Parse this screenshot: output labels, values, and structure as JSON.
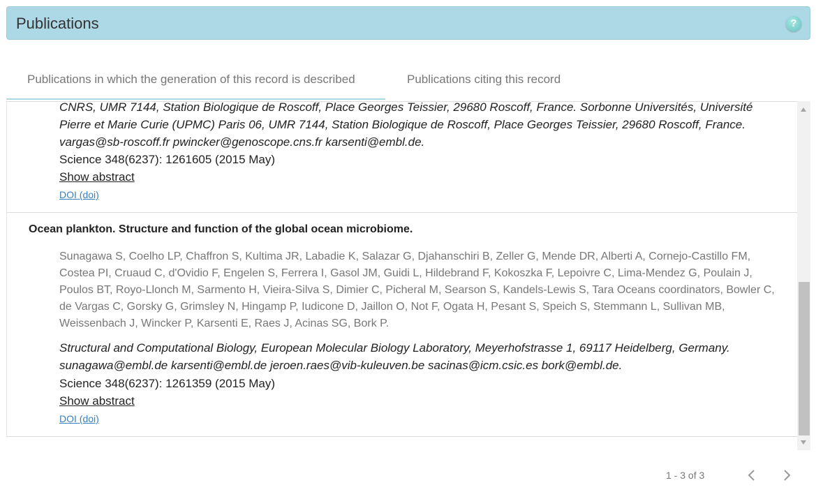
{
  "panel": {
    "title": "Publications",
    "help_icon": "?"
  },
  "tabs": [
    {
      "label": "Publications in which the generation of this record is described",
      "active": true
    },
    {
      "label": "Publications citing this record",
      "active": false
    }
  ],
  "publications": [
    {
      "affiliation": "CNRS, UMR 7144, Station Biologique de Roscoff, Place Georges Teissier, 29680 Roscoff, France. Sorbonne Universités, Université Pierre et Marie Curie (UPMC) Paris 06, UMR 7144, Station Biologique de Roscoff, Place Georges Teissier, 29680 Roscoff, France. vargas@sb-roscoff.fr pwincker@genoscope.cns.fr karsenti@embl.de.",
      "journal": "Science 348(6237): 1261605 (2015 May)",
      "show_abstract": "Show abstract",
      "doi_label": "DOI (doi)"
    },
    {
      "title": "Ocean plankton. Structure and function of the global ocean microbiome.",
      "authors": "Sunagawa S, Coelho LP, Chaffron S, Kultima JR, Labadie K, Salazar G, Djahanschiri B, Zeller G, Mende DR, Alberti A, Cornejo-Castillo FM, Costea PI, Cruaud C, d'Ovidio F, Engelen S, Ferrera I, Gasol JM, Guidi L, Hildebrand F, Kokoszka F, Lepoivre C, Lima-Mendez G, Poulain J, Poulos BT, Royo-Llonch M, Sarmento H, Vieira-Silva S, Dimier C, Picheral M, Searson S, Kandels-Lewis S, Tara Oceans coordinators, Bowler C, de Vargas C, Gorsky G, Grimsley N, Hingamp P, Iudicone D, Jaillon O, Not F, Ogata H, Pesant S, Speich S, Stemmann L, Sullivan MB, Weissenbach J, Wincker P, Karsenti E, Raes J, Acinas SG, Bork P.",
      "affiliation": "Structural and Computational Biology, European Molecular Biology Laboratory, Meyerhofstrasse 1, 69117 Heidelberg, Germany. sunagawa@embl.de karsenti@embl.de jeroen.raes@vib-kuleuven.be sacinas@icm.csic.es bork@embl.de.",
      "journal": "Science 348(6237): 1261359 (2015 May)",
      "show_abstract": "Show abstract",
      "doi_label": "DOI (doi)"
    }
  ],
  "pagination": {
    "range_text": "1 - 3 of 3",
    "prev_icon": "chevron-left-icon",
    "next_icon": "chevron-right-icon"
  },
  "colors": {
    "header_bg": "#add8e6",
    "help_icon": "#63c4c0",
    "link": "#3a7fbf"
  }
}
